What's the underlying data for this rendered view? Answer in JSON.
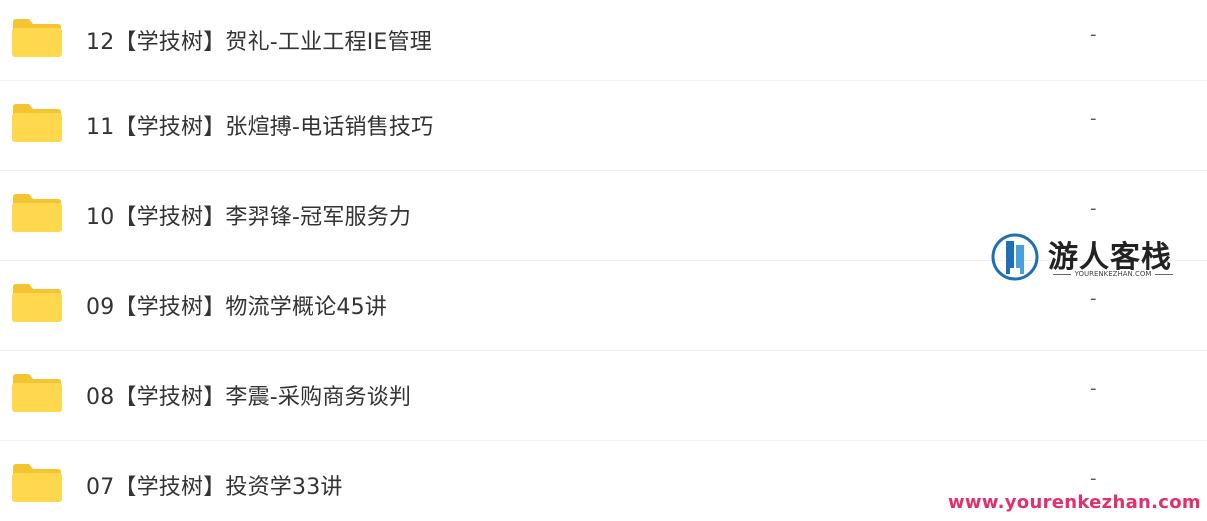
{
  "files": [
    {
      "name": "12【学技树】贺礼-工业工程IE管理",
      "size": "-"
    },
    {
      "name": "11【学技树】张煊搏-电话销售技巧",
      "size": "-"
    },
    {
      "name": "10【学技树】李羿锋-冠军服务力",
      "size": "-"
    },
    {
      "name": "09【学技树】物流学概论45讲",
      "size": "-"
    },
    {
      "name": "08【学技树】李震-采购商务谈判",
      "size": "-"
    },
    {
      "name": "07【学技树】投资学33讲",
      "size": "-"
    }
  ],
  "watermark": {
    "title": "游人客栈",
    "subtitle": "YOURENKEZHAN.COM",
    "url": "www.yourenkezhan.com",
    "url_color": "#e2306c"
  },
  "colors": {
    "folder_body": "#FFD84D",
    "folder_tab": "#F5C431"
  }
}
